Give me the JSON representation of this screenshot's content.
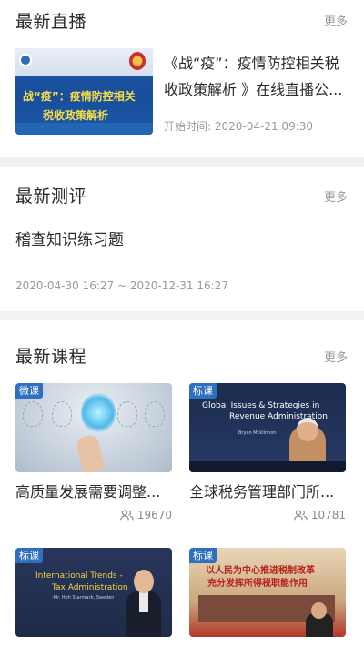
{
  "live": {
    "title": "最新直播",
    "more": "更多",
    "item": {
      "title": "《战“疫”：疫情防控相关税收政策解析 》在线直播公...",
      "time_label": "开始时间:",
      "time_value": "2020-04-21 09:30",
      "thumb_line1": "战“疫”：疫情防控相关",
      "thumb_line2": "税收政策解析"
    }
  },
  "test": {
    "title": "最新测评",
    "more": "更多",
    "item": {
      "name": "稽查知识练习题",
      "date_range": "2020-04-30 16:27 ~ 2020-12-31 16:27"
    }
  },
  "course": {
    "title": "最新课程",
    "more": "更多",
    "items": [
      {
        "badge": "微课",
        "title": "高质量发展需要调整...",
        "views": "19670"
      },
      {
        "badge": "标课",
        "title": "全球税务管理部门所...",
        "views": "10781",
        "thumb_line1": "Global Issues & Strategies in",
        "thumb_line2": "Revenue Administration",
        "thumb_name": "Bryan Mcklinnon"
      },
      {
        "badge": "标课",
        "title": "",
        "views": "",
        "thumb_line1": "International Trends -",
        "thumb_line2": "Tax Administration",
        "thumb_sub": "-Mr. Hoh Starmark, Sweden"
      },
      {
        "badge": "标课",
        "title": "",
        "views": "",
        "thumb_line1": "以人民为中心推进税制改革",
        "thumb_line2": "充分发挥所得税职能作用"
      }
    ]
  },
  "colors": {
    "accent": "#2f6fc1",
    "badge_bg": "#2f6fc1",
    "muted": "#9a9a9a"
  },
  "icons": {
    "views": "users-icon"
  }
}
